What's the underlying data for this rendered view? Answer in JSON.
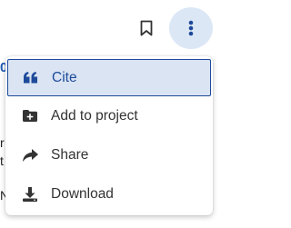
{
  "background": {
    "fragments": [
      "0",
      "r",
      "t",
      "N"
    ]
  },
  "toolbar": {
    "bookmark_icon": "bookmark-icon",
    "more_icon": "vertical-ellipsis-icon"
  },
  "menu": {
    "items": [
      {
        "label": "Cite",
        "icon": "quote-icon",
        "active": true
      },
      {
        "label": "Add to project",
        "icon": "folder-add-icon",
        "active": false
      },
      {
        "label": "Share",
        "icon": "share-arrow-icon",
        "active": false
      },
      {
        "label": "Download",
        "icon": "download-icon",
        "active": false
      }
    ]
  },
  "colors": {
    "accent": "#1d4a9a",
    "active_bg": "#dae4f3",
    "more_button_bg": "#dce7f6",
    "icon": "#333333"
  }
}
